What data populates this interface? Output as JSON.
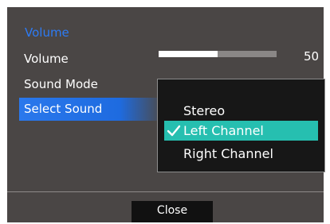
{
  "osd": {
    "section_title": "Volume",
    "rows": [
      {
        "label": "Volume"
      },
      {
        "label": "Sound Mode"
      },
      {
        "label": "Select Sound"
      }
    ],
    "volume": {
      "value": 50,
      "value_text": "50",
      "fill_fraction": 0.5
    }
  },
  "dropdown": {
    "options": [
      {
        "label": "Stereo",
        "selected": false
      },
      {
        "label": "Left Channel",
        "selected": true
      },
      {
        "label": "Right Channel",
        "selected": false
      }
    ],
    "selected_icon": "checkmark-icon",
    "highlight_color": "#26bfb0"
  },
  "footer": {
    "close_label": "Close"
  },
  "colors": {
    "panel_bg": "#4a4645",
    "accent_blue": "#2d7bf4",
    "selected_row": "#1e6be0"
  }
}
